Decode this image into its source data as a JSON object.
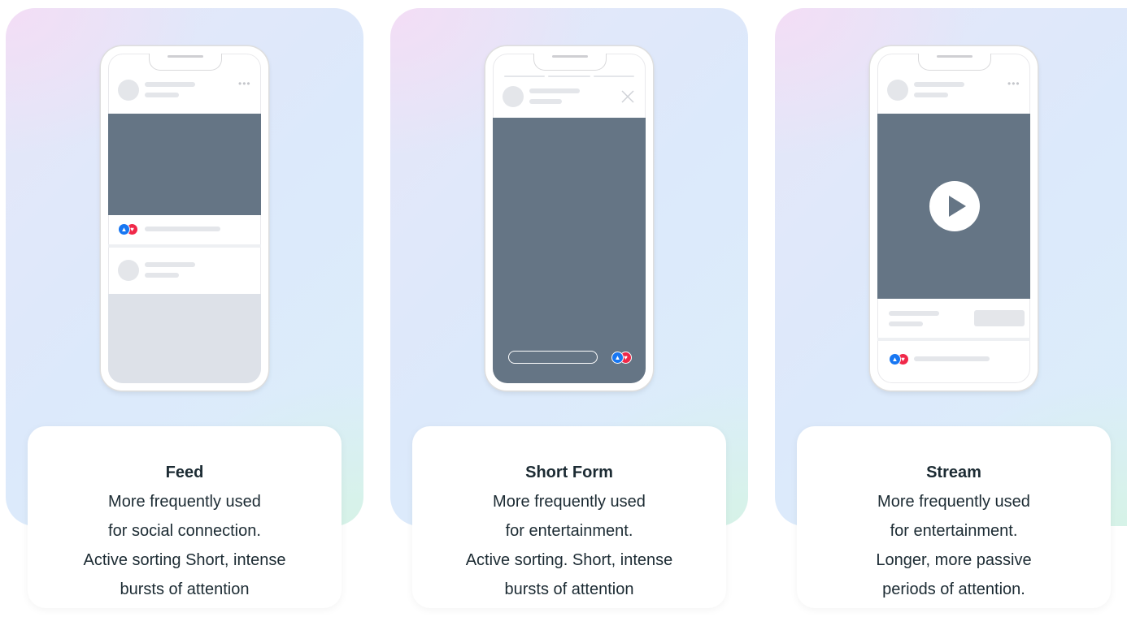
{
  "cards": [
    {
      "title": "Feed",
      "lines": [
        "More frequently used",
        "for social connection.",
        "Active sorting Short, intense",
        "bursts of attention"
      ]
    },
    {
      "title": "Short Form",
      "lines": [
        "More frequently used",
        "for entertainment.",
        "Active sorting. Short, intense",
        "bursts of attention"
      ]
    },
    {
      "title": "Stream",
      "lines": [
        "More frequently used",
        "for entertainment.",
        "Longer, more passive",
        "periods of attention."
      ]
    }
  ],
  "icons": {
    "more": "more-dots-icon",
    "close": "close-icon",
    "play": "play-icon",
    "like": "like-reaction-icon",
    "love": "love-reaction-icon"
  },
  "colors": {
    "media": "#657585",
    "placeholder": "#e4e6ea",
    "like": "#1877f2",
    "love": "#f02849",
    "text": "#1c2b33"
  }
}
